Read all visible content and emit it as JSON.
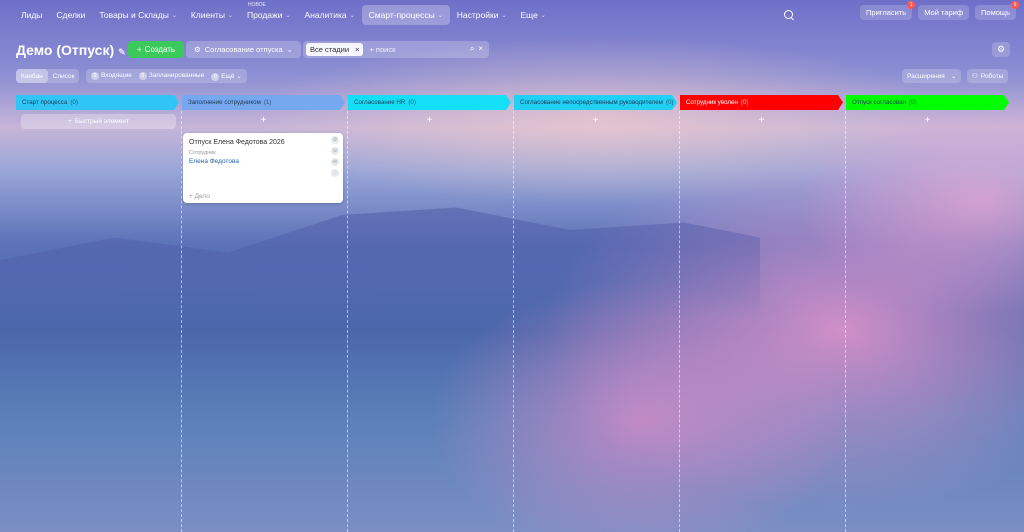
{
  "nav": {
    "items": [
      {
        "label": "Лиды",
        "chevron": false
      },
      {
        "label": "Сделки",
        "chevron": false
      },
      {
        "label": "Товары и Склады",
        "chevron": true
      },
      {
        "label": "Клиенты",
        "chevron": true
      },
      {
        "label": "Продажи",
        "chevron": true,
        "badge": "НОВОЕ"
      },
      {
        "label": "Аналитика",
        "chevron": true
      },
      {
        "label": "Смарт-процессы",
        "chevron": true,
        "active": true
      },
      {
        "label": "Настройки",
        "chevron": true
      },
      {
        "label": "Еще",
        "chevron": true
      }
    ],
    "invite": "Пригласить",
    "invite_badge": "1",
    "tariff": "Мой тариф",
    "help": "Помощь",
    "help_badge": "9"
  },
  "toolbar": {
    "title": "Демо (Отпуск)",
    "create": "Создать",
    "flow": "Согласование отпуска",
    "stage_filter": "Все стадии",
    "search_placeholder": "+ поиск"
  },
  "views": {
    "kanban": "Канбан",
    "list": "Список",
    "incoming_count": "0",
    "incoming": "Входящие",
    "planned_count": "0",
    "planned": "Запланированные",
    "more_count": "0",
    "more": "Ещё",
    "extensions": "Расширения",
    "robots": "Роботы"
  },
  "columns": [
    {
      "name": "Старт процесса",
      "count": "(0)",
      "color": "#2fc6f6",
      "text": "#1f3a55"
    },
    {
      "name": "Заполнение сотрудником",
      "count": "(1)",
      "color": "#76a8f0",
      "text": "#1f3a55"
    },
    {
      "name": "Согласование HR",
      "count": "(0)",
      "color": "#13e0f7",
      "text": "#1f3a55"
    },
    {
      "name": "Согласование непосредственным руководителем",
      "count": "(0)",
      "color": "#20d0f5",
      "text": "#1f3a55"
    },
    {
      "name": "Сотрудник уволен",
      "count": "(0)",
      "color": "#ff0000",
      "text": "#ffffff"
    },
    {
      "name": "Отпуск согласован",
      "count": "(0)",
      "color": "#00ff00",
      "text": "#1f3a55"
    }
  ],
  "quick_add": "Быстрый элемент",
  "card": {
    "title": "Отпуск Елена Федотова 2026",
    "label": "Сотрудник",
    "employee": "Елена Федотова",
    "deal": "+ Дело"
  }
}
